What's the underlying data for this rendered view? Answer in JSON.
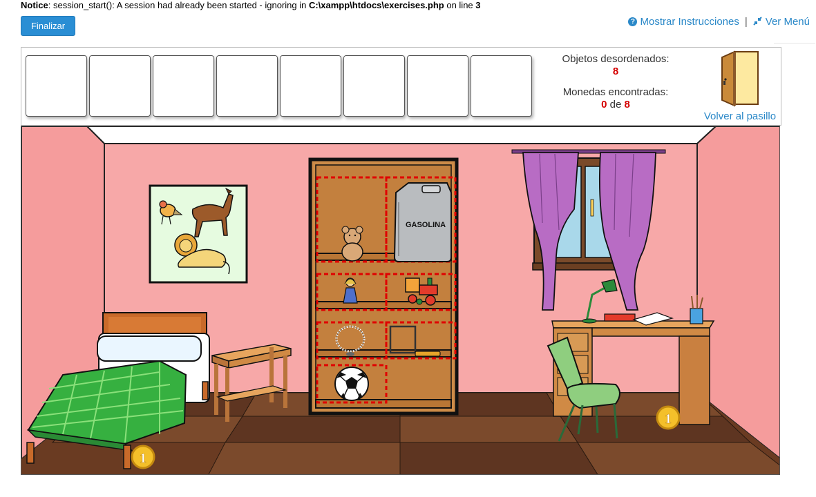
{
  "notice": {
    "label": "Notice",
    "message": ": session_start(): A session had already been started - ignoring in ",
    "file": "C:\\xampp\\htdocs\\exercises.php",
    "line_text": " on line ",
    "line_number": "3"
  },
  "toolbar": {
    "finalizar_label": "Finalizar",
    "instructions_label": "Mostrar Instrucciones",
    "separator": "|",
    "menu_label": "Ver Menú"
  },
  "inventory": {
    "slot_count": 8
  },
  "stats": {
    "disordered_label": "Objetos desordenados:",
    "disordered_value": "8",
    "coins_label": "Monedas encontradas:",
    "coins_found": "0",
    "coins_of": " de ",
    "coins_total": "8"
  },
  "door": {
    "label": "Volver al pasillo"
  },
  "scene": {
    "gasoline_label": "GASOLINA",
    "coin_digit": "1",
    "colors": {
      "wall": "#f7a8a8",
      "ceiling": "#ffffff",
      "floor_dark": "#5e3521",
      "floor_mid": "#7b4a2c",
      "shelf": "#cd8b48",
      "shelf_dark": "#2a1a10",
      "dashed": "#e00000",
      "curtain": "#b86cc4",
      "window_glass": "#a9d8ea",
      "bed_green": "#36b040",
      "desk": "#d49a55",
      "chair": "#8fce7f"
    }
  }
}
